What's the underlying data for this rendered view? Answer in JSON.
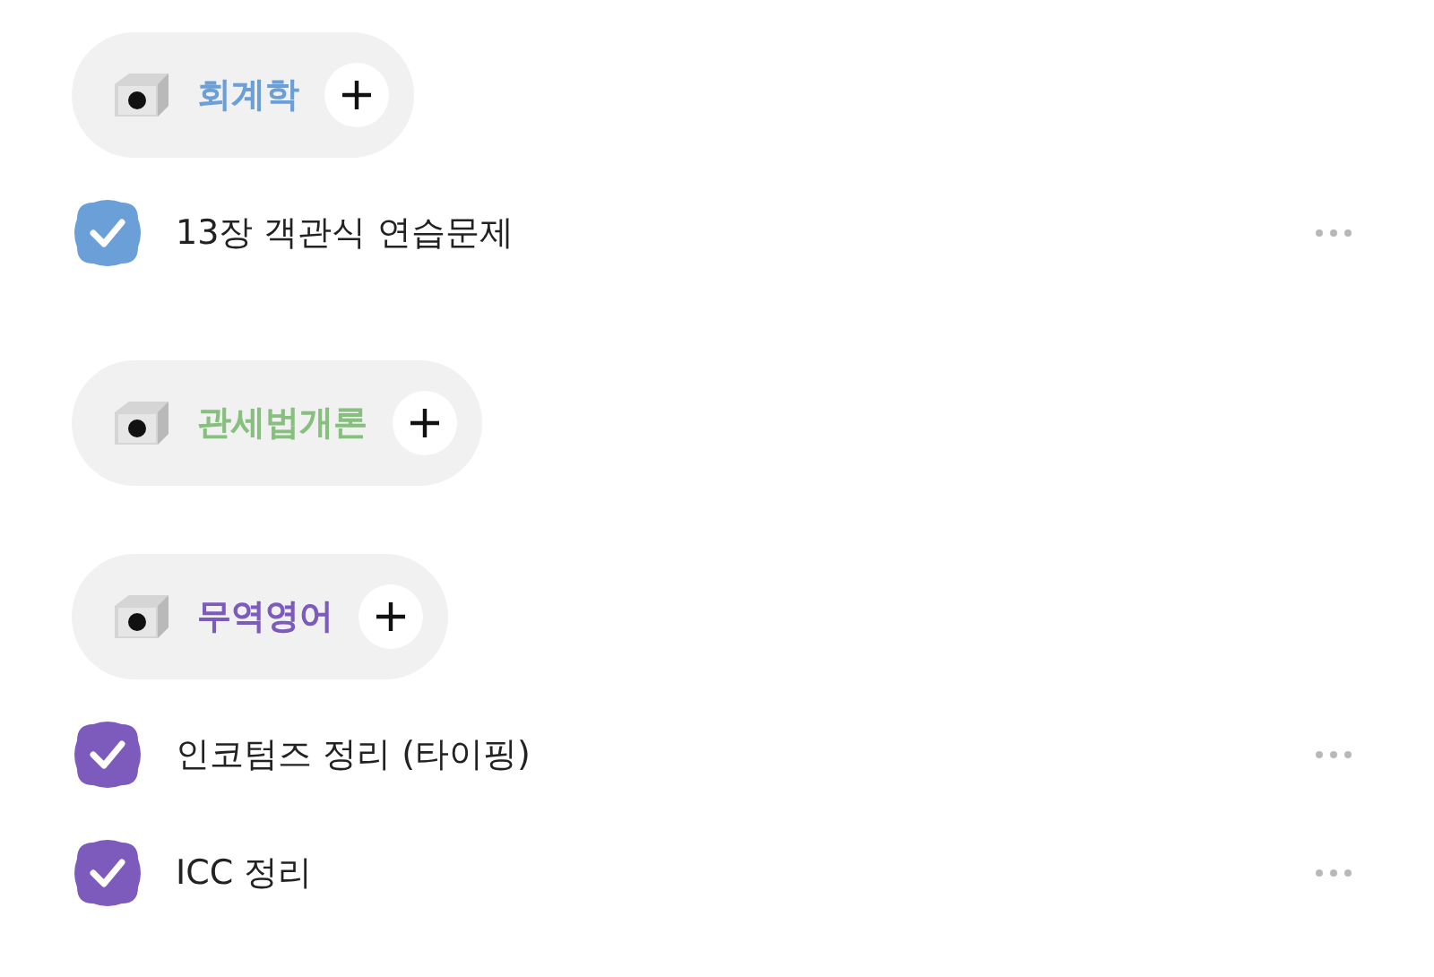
{
  "categories": [
    {
      "name": "회계학",
      "color": "#6a9fd8",
      "items": [
        {
          "title": "13장 객관식 연습문제",
          "checked": true
        }
      ]
    },
    {
      "name": "관세법개론",
      "color": "#86bf7e"
    },
    {
      "name": "무역영어",
      "color": "#7c5bbd",
      "items": [
        {
          "title": "인코텀즈 정리 (타이핑)",
          "checked": true
        },
        {
          "title": "ICC 정리",
          "checked": true
        }
      ]
    }
  ]
}
